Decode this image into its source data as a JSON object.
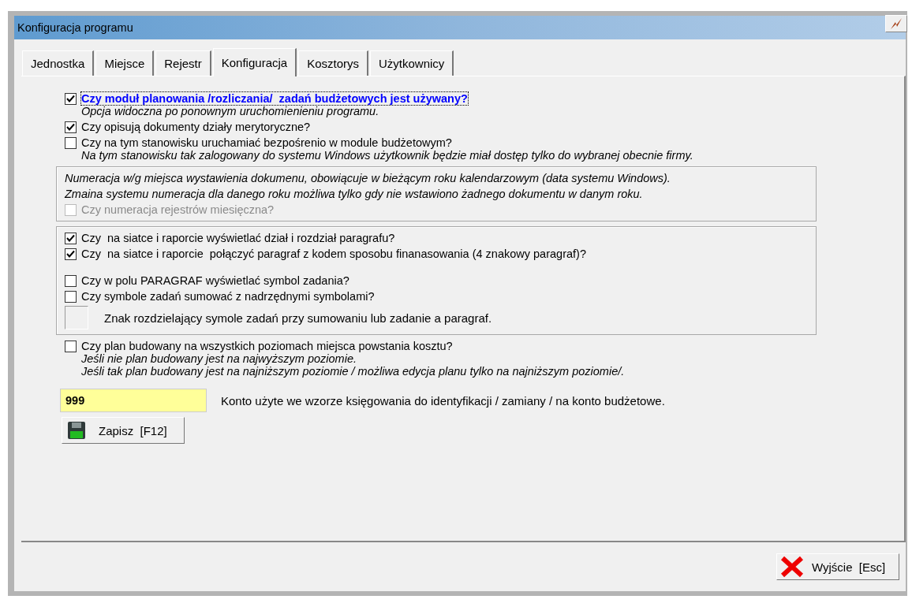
{
  "window": {
    "title": "Konfiguracja programu"
  },
  "tabs": [
    {
      "label": "Jednostka",
      "selected": false
    },
    {
      "label": "Miejsce",
      "selected": false
    },
    {
      "label": "Rejestr",
      "selected": false
    },
    {
      "label": "Konfiguracja",
      "selected": true
    },
    {
      "label": "Kosztorys",
      "selected": false
    },
    {
      "label": "Użytkownicy",
      "selected": false
    }
  ],
  "groups": [
    {
      "framed": false,
      "blocks": [
        [
          {
            "kind": "checkbox",
            "label": "Czy moduł planowania /rozliczania/  zadań budżetowych jest używany?",
            "checked": true,
            "disabled": false,
            "focused": true,
            "notes": [
              "Opcja widoczna po ponownym uruchomienieniu programu."
            ]
          },
          {
            "kind": "checkbox",
            "label": "Czy opisują dokumenty działy merytoryczne?",
            "checked": true,
            "disabled": false,
            "focused": false
          },
          {
            "kind": "checkbox",
            "label": "Czy na tym stanowisku uruchamiać bezpośrenio w module budżetowym?",
            "checked": false,
            "disabled": false,
            "focused": false,
            "notes": [
              "Na tym stanowisku tak zalogowany do systemu Windows użytkownik będzie miał dostęp tylko do wybranej obecnie firmy."
            ]
          }
        ]
      ]
    },
    {
      "framed": true,
      "blocks": [
        [
          {
            "kind": "note",
            "text": "Numeracja w/g miejsca wystawienia dokumenu, obowiącuje w bieżącym roku kalendarzowym (data systemu Windows)."
          },
          {
            "kind": "note",
            "text": "Zmaina systemu numeracja dla danego roku możliwa tylko gdy nie wstawiono żadnego dokumentu w danym roku."
          },
          {
            "kind": "checkbox",
            "label": "Czy numeracja rejestrów miesięczna?",
            "checked": false,
            "disabled": true,
            "focused": false
          }
        ]
      ]
    },
    {
      "framed": true,
      "blocks": [
        [
          {
            "kind": "checkbox",
            "label": "Czy  na siatce i raporcie wyświetlać dział i rozdział paragrafu?",
            "checked": true,
            "disabled": false,
            "focused": false
          },
          {
            "kind": "checkbox",
            "label": "Czy  na siatce i raporcie  połączyć paragraf z kodem sposobu finanasowania (4 znakowy paragraf)?",
            "checked": true,
            "disabled": false,
            "focused": false
          }
        ],
        [
          {
            "kind": "checkbox",
            "label": "Czy w polu PARAGRAF wyświetlać symbol zadania?",
            "checked": false,
            "disabled": false,
            "focused": false
          },
          {
            "kind": "checkbox",
            "label": "Czy symbole zadań sumować z nadrzędnymi symbolami?",
            "checked": false,
            "disabled": false,
            "focused": false
          },
          {
            "kind": "char_field",
            "label": "Znak rozdzielający symole zadań przy sumowaniu lub zadanie a paragraf."
          }
        ]
      ]
    },
    {
      "framed": false,
      "blocks": [
        [
          {
            "kind": "checkbox",
            "label": "Czy plan budowany na wszystkich poziomach miejsca powstania kosztu?",
            "checked": false,
            "disabled": false,
            "focused": false,
            "notes": [
              "Jeśli nie plan budowany jest na najwyższym poziomie.",
              "Jeśli tak plan budowany jest na najniższym poziomie / możliwa edycja planu tylko na najniższym poziomie/."
            ]
          }
        ]
      ]
    }
  ],
  "account": {
    "value": "999",
    "label": "Konto użyte we wzorze księgowania do identyfikacji / zamiany / na konto budżetowe."
  },
  "save_button": {
    "label": "Zapisz  [F12]"
  },
  "exit_button": {
    "label": "Wyjście  [Esc]"
  }
}
